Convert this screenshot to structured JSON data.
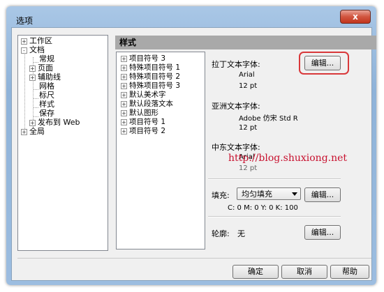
{
  "window": {
    "title": "选项",
    "close_glyph": "x"
  },
  "tree": {
    "items": [
      {
        "label": "工作区",
        "expander": "+"
      },
      {
        "label": "文档",
        "expander": "-"
      },
      {
        "label": "常规"
      },
      {
        "label": "页面",
        "expander": "+"
      },
      {
        "label": "辅助线",
        "expander": "+"
      },
      {
        "label": "网格"
      },
      {
        "label": "标尺"
      },
      {
        "label": "样式"
      },
      {
        "label": "保存"
      },
      {
        "label": "发布到 Web",
        "expander": "+"
      },
      {
        "label": "全局",
        "expander": "+"
      }
    ]
  },
  "panel": {
    "header": "样式"
  },
  "styles_list": {
    "items": [
      {
        "label": "项目符号 3",
        "expander": "+"
      },
      {
        "label": "特殊项目符号 1",
        "expander": "+"
      },
      {
        "label": "特殊项目符号 2",
        "expander": "+"
      },
      {
        "label": "特殊项目符号 3",
        "expander": "+"
      },
      {
        "label": "默认美术字",
        "expander": "+"
      },
      {
        "label": "默认段落文本",
        "expander": "+"
      },
      {
        "label": "默认图形",
        "expander": "+"
      },
      {
        "label": "项目符号 1",
        "expander": "+"
      },
      {
        "label": "项目符号 2",
        "expander": "+"
      }
    ]
  },
  "latin_font": {
    "label": "拉丁文本字体:",
    "name": "Arial",
    "size": "12 pt",
    "edit": "编辑..."
  },
  "asian_font": {
    "label": "亚洲文本字体:",
    "name": "Adobe 仿宋 Std R",
    "size": "12 pt"
  },
  "middle_east_font": {
    "label": "中东文本字体:",
    "name": "Arial",
    "size": "12 pt"
  },
  "fill": {
    "label": "填充:",
    "value": "均匀填充",
    "edit": "编辑...",
    "color": "C: 0 M: 0 Y: 0 K: 100"
  },
  "outline": {
    "label": "轮廓:",
    "value": "无",
    "edit": "编辑..."
  },
  "footer": {
    "ok": "确定",
    "cancel": "取消",
    "help": "帮助"
  },
  "watermark": "http://blog.shuxiong.net",
  "colors": {
    "highlight": "#d9383a",
    "watermark": "#c8102e",
    "header_bg": "#a9a9a9"
  }
}
